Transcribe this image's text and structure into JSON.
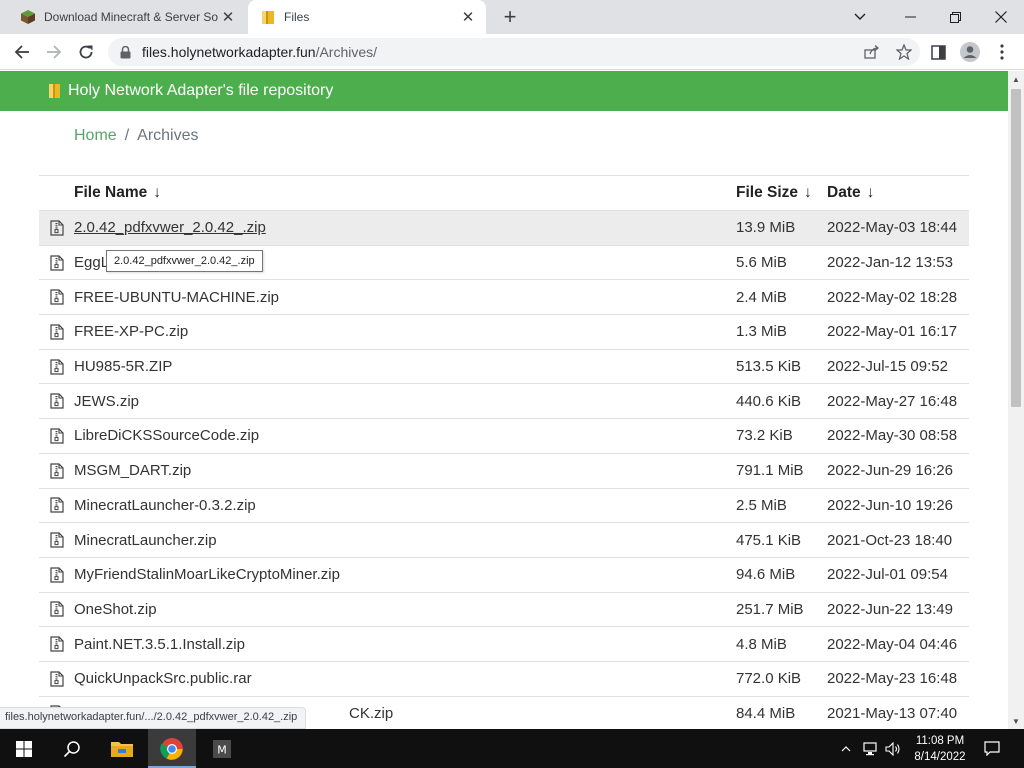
{
  "browser": {
    "tabs": [
      {
        "title": "Download Minecraft & Server So",
        "active": false
      },
      {
        "title": "Files",
        "active": true
      }
    ],
    "url_host": "files.holynetworkadapter.fun",
    "url_path": "/Archives/"
  },
  "page": {
    "banner_title": "Holy Network Adapter's file repository",
    "breadcrumb": {
      "home": "Home",
      "separator": "/",
      "current": "Archives"
    },
    "table": {
      "headers": {
        "name": "File Name",
        "size": "File Size",
        "date": "Date",
        "sort_arrow": "↓"
      },
      "rows": [
        {
          "name": "2.0.42_pdfxvwer_2.0.42_.zip",
          "size": "13.9 MiB",
          "date": "2022-May-03 18:44"
        },
        {
          "name": "EggL",
          "size": "5.6 MiB",
          "date": "2022-Jan-12 13:53"
        },
        {
          "name": "FREE-UBUNTU-MACHINE.zip",
          "size": "2.4 MiB",
          "date": "2022-May-02 18:28"
        },
        {
          "name": "FREE-XP-PC.zip",
          "size": "1.3 MiB",
          "date": "2022-May-01 16:17"
        },
        {
          "name": "HU985-5R.ZIP",
          "size": "513.5 KiB",
          "date": "2022-Jul-15 09:52"
        },
        {
          "name": "JEWS.zip",
          "size": "440.6 KiB",
          "date": "2022-May-27 16:48"
        },
        {
          "name": "LibreDiCKSSourceCode.zip",
          "size": "73.2 KiB",
          "date": "2022-May-30 08:58"
        },
        {
          "name": "MSGM_DART.zip",
          "size": "791.1 MiB",
          "date": "2022-Jun-29 16:26"
        },
        {
          "name": "MinecratLauncher-0.3.2.zip",
          "size": "2.5 MiB",
          "date": "2022-Jun-10 19:26"
        },
        {
          "name": "MinecratLauncher.zip",
          "size": "475.1 KiB",
          "date": "2021-Oct-23 18:40"
        },
        {
          "name": "MyFriendStalinMoarLikeCryptoMiner.zip",
          "size": "94.6 MiB",
          "date": "2022-Jul-01 09:54"
        },
        {
          "name": "OneShot.zip",
          "size": "251.7 MiB",
          "date": "2022-Jun-22 13:49"
        },
        {
          "name": "Paint.NET.3.5.1.Install.zip",
          "size": "4.8 MiB",
          "date": "2022-May-04 04:46"
        },
        {
          "name": "QuickUnpackSrc.public.rar",
          "size": "772.0 KiB",
          "date": "2022-May-23 16:48"
        },
        {
          "name": "CK.zip",
          "size": "84.4 MiB",
          "date": "2021-May-13 07:40"
        }
      ]
    },
    "tooltip": "2.0.42_pdfxvwer_2.0.42_.zip"
  },
  "status_url": "files.holynetworkadapter.fun/.../2.0.42_pdfxvwer_2.0.42_.zip",
  "taskbar": {
    "time": "11:08 PM",
    "date": "8/14/2022"
  },
  "colors": {
    "banner": "#4cae4c",
    "home_link": "#5aa469",
    "taskbar": "#101010"
  }
}
